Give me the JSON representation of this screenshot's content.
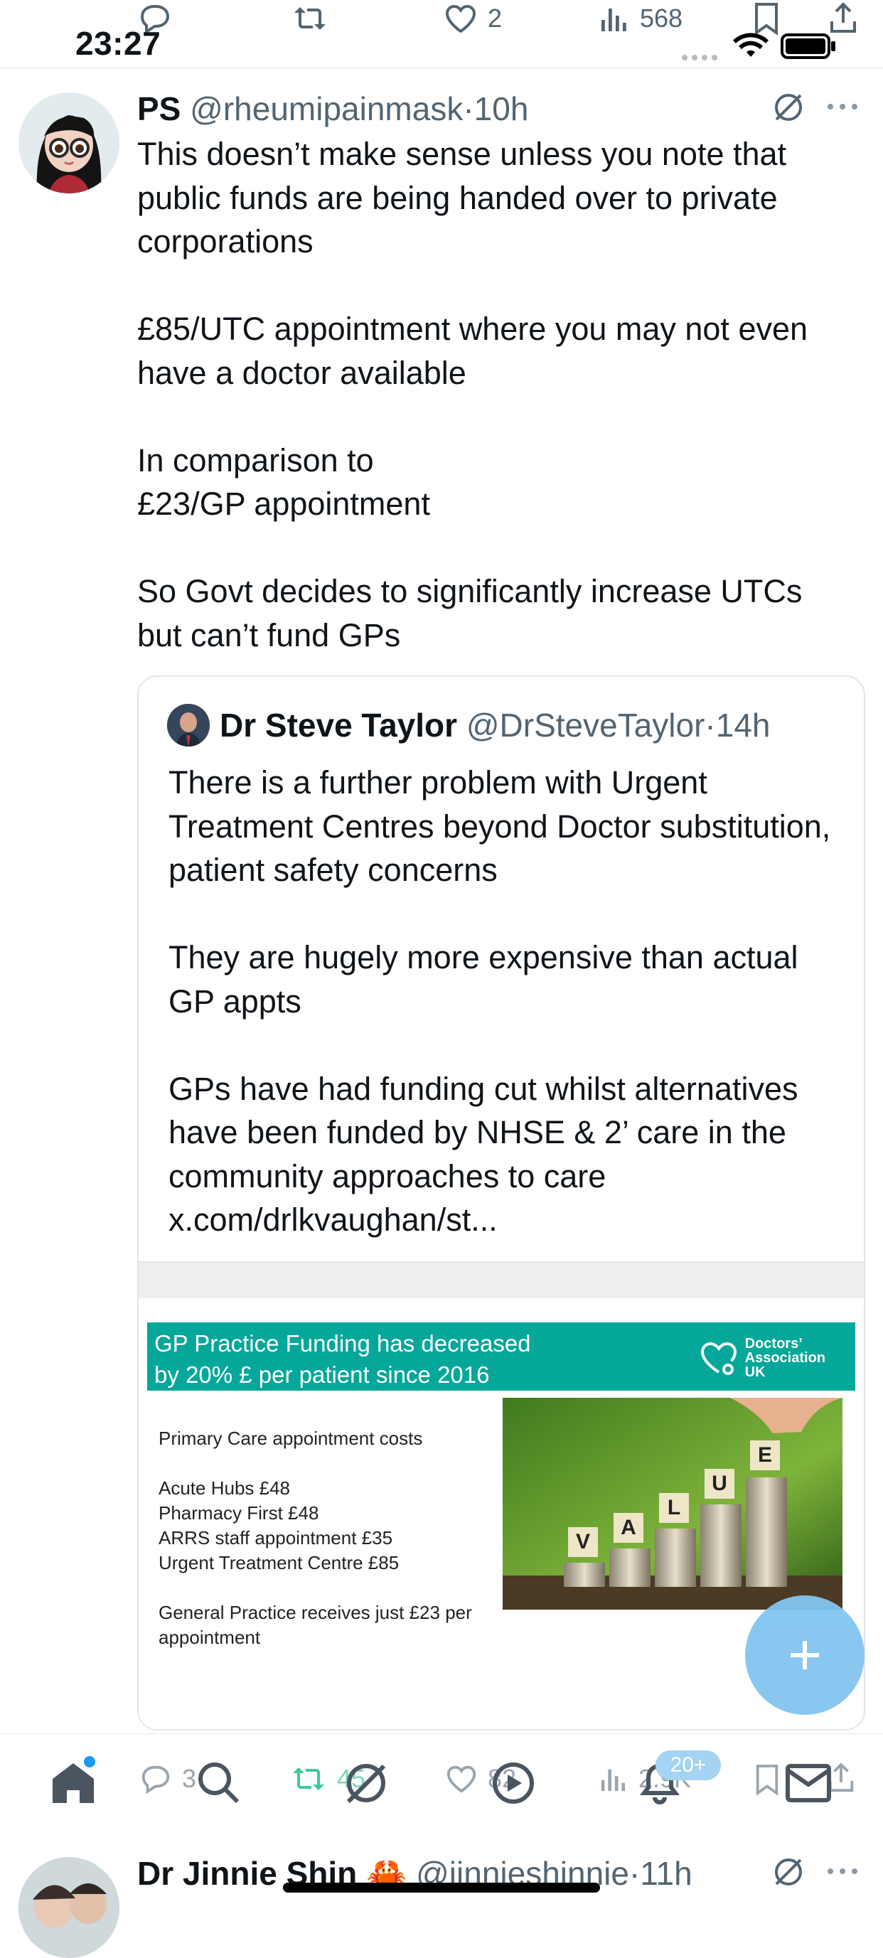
{
  "status_bar": {
    "time": "23:27"
  },
  "prev_tweet_actions": {
    "likes": "2",
    "views": "568"
  },
  "tweet": {
    "display_name": "PS",
    "handle": "@rheumipainmask",
    "separator": "·",
    "age": "10h",
    "paragraphs": [
      "This doesn’t make sense unless you note that public funds are being handed over to private corporations",
      "£85/UTC appointment where you may not even have a doctor available",
      "In comparison to\n£23/GP appointment",
      "So Govt decides to significantly increase UTCs but can’t fund GPs"
    ]
  },
  "quote": {
    "display_name": "Dr Steve Taylor",
    "handle": "@DrSteveTaylor",
    "separator": "·",
    "age": "14h",
    "paragraphs": [
      "There is a further problem with Urgent Treatment Centres beyond Doctor substitution, patient safety concerns",
      "They are hugely more expensive than actual GP appts",
      "GPs have had funding cut whilst alternatives have been funded by NHSE & 2’ care in the community approaches to care x.com/drlkvaughan/st..."
    ],
    "card": {
      "banner_line1": "GP Practice Funding has decreased",
      "banner_line2": "by 20% £ per patient since 2016",
      "logo_line1": "Doctors’",
      "logo_line2": "Association",
      "logo_line3": "UK",
      "heading": "Primary Care appointment costs",
      "items": [
        "Acute Hubs £48",
        "Pharmacy First £48",
        "ARRS staff appointment £35",
        "Urgent Treatment Centre £85"
      ],
      "footer_line1": "General Practice receives just £23 per",
      "footer_line2": "appointment",
      "image_letters": [
        "V",
        "A",
        "L",
        "U",
        "E"
      ]
    }
  },
  "tweet_actions": {
    "replies": "3",
    "reposts": "45",
    "likes": "82",
    "views": "2.9K"
  },
  "nav": {
    "badge": "20+"
  },
  "next_tweet": {
    "display_name": "Dr Jinnie Shin",
    "emoji": "🦀",
    "handle": "@jinnieshinnie",
    "separator": "·",
    "age": "11h"
  },
  "colors": {
    "accent": "#1d9bf0",
    "repost_green": "#00ba7c",
    "banner_teal": "#05a79a",
    "fab": "#83c5f1"
  }
}
